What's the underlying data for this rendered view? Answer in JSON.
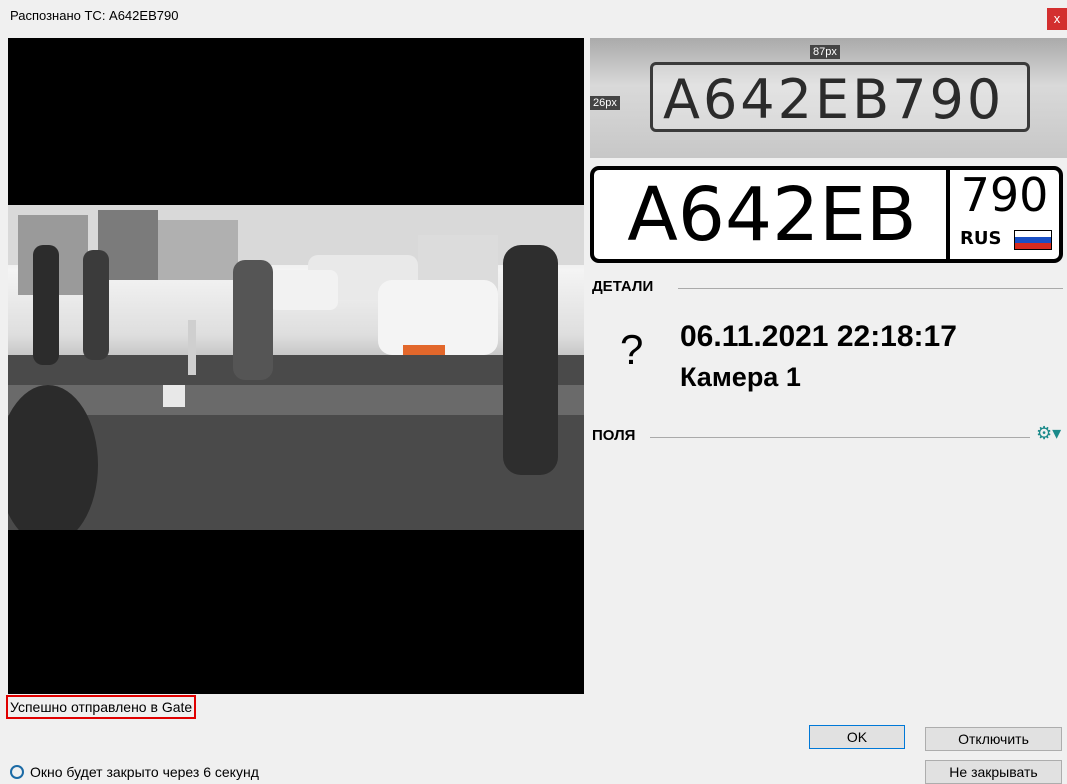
{
  "window": {
    "title": "Распознано ТС: А642ЕВ790",
    "close_label": "x"
  },
  "plate_crop": {
    "text": "А642ЕВ790",
    "width_label": "87px",
    "height_label": "26px"
  },
  "plate": {
    "main": "А642ЕВ",
    "region": "790",
    "country": "RUS"
  },
  "details": {
    "header": "ДЕТАЛИ",
    "unknown_symbol": "?",
    "datetime": "06.11.2021 22:18:17",
    "camera": "Камера 1"
  },
  "fields": {
    "header": "ПОЛЯ",
    "settings_icon": "gear-icon"
  },
  "status": {
    "message": "Успешно отправлено в Gate"
  },
  "buttons": {
    "ok": "OK",
    "disable": "Отключить",
    "keep_open": "Не закрывать"
  },
  "timer": {
    "icon": "timer-icon",
    "text": "Окно будет закрыто через 6 секунд"
  },
  "colors": {
    "close_button": "#d32f2f",
    "status_border": "#e00000",
    "accent": "#1b8a8a"
  }
}
